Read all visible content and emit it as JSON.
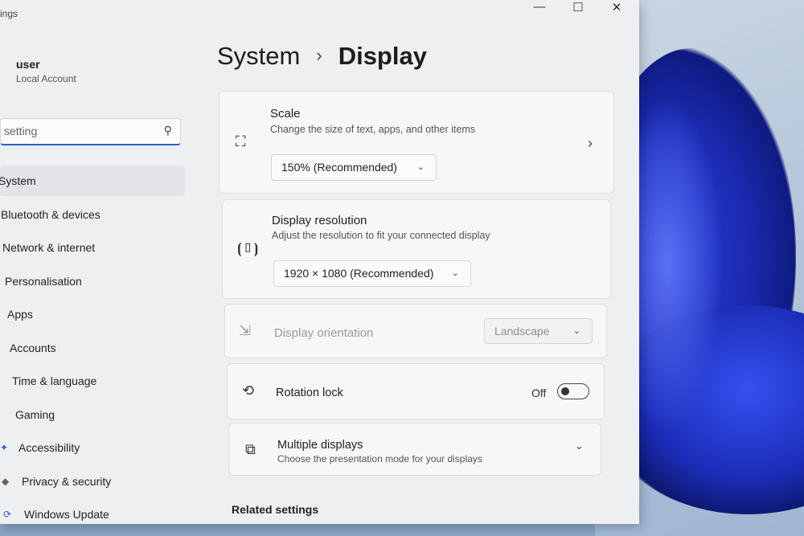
{
  "window": {
    "app_title": "ings"
  },
  "user": {
    "name": "user",
    "account_type": "Local Account"
  },
  "search": {
    "value": "setting"
  },
  "nav": [
    {
      "label": "System",
      "active": true
    },
    {
      "label": "Bluetooth & devices"
    },
    {
      "label": "Network & internet"
    },
    {
      "label": "Personalisation"
    },
    {
      "label": "Apps"
    },
    {
      "label": "Accounts"
    },
    {
      "label": "Time & language"
    },
    {
      "label": "Gaming"
    },
    {
      "label": "Accessibility"
    },
    {
      "label": "Privacy & security"
    },
    {
      "label": "Windows Update"
    }
  ],
  "breadcrumb": {
    "parent": "System",
    "separator": "›",
    "current": "Display"
  },
  "cards": {
    "scale": {
      "title": "Scale",
      "subtitle": "Change the size of text, apps, and other items",
      "value": "150% (Recommended)"
    },
    "resolution": {
      "title": "Display resolution",
      "subtitle": "Adjust the resolution to fit your connected display",
      "value": "1920 × 1080 (Recommended)"
    },
    "orientation": {
      "title": "Display orientation",
      "value": "Landscape",
      "disabled": true
    },
    "rotation_lock": {
      "title": "Rotation lock",
      "state_label": "Off",
      "on": false
    },
    "multiple_displays": {
      "title": "Multiple displays",
      "subtitle": "Choose the presentation mode for your displays"
    }
  },
  "related_settings": {
    "heading": "Related settings"
  },
  "colors": {
    "accent": "#2a62c9",
    "window_bg": "#eeeff1",
    "card_bg": "#f7f7f8"
  }
}
